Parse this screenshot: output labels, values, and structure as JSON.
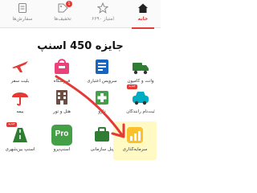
{
  "nav": {
    "home": {
      "label": "خانه",
      "icon": "home-icon"
    },
    "points": {
      "label": "۶۶۹۰ امتیاز",
      "icon": "star-icon"
    },
    "offers": {
      "label": "تخفیف‌ها",
      "badge": "1",
      "icon": "percent-tag-icon"
    },
    "orders": {
      "label": "سفارش‌ها",
      "icon": "orders-icon"
    }
  },
  "banner": {
    "text": "جایزه 450 اسنپ"
  },
  "tiles": [
    {
      "label": "وانت و کامیون",
      "icon": "truck-icon",
      "color": "#2e7d32"
    },
    {
      "label": "سرویس اعتباری",
      "icon": "credit-icon",
      "color": "#1565c0"
    },
    {
      "label": "فروشگاه",
      "icon": "shop-icon",
      "color": "#ec407a"
    },
    {
      "label": "بلیت سفر",
      "icon": "plane-icon",
      "color": "#e53935"
    },
    {
      "label": "ثبت‌نام رانندگان",
      "icon": "driver-icon",
      "color": "#00acc1",
      "tag": "جدید"
    },
    {
      "label": "دارو",
      "icon": "pharmacy-icon",
      "color": "#43a047"
    },
    {
      "label": "هتل و تور",
      "icon": "hotel-icon",
      "color": "#6d4c41"
    },
    {
      "label": "بیمه",
      "icon": "umbrella-icon",
      "color": "#e53935"
    },
    {
      "label": "سرمایه‌گذاری",
      "icon": "investment-icon",
      "color": "#fbc02d"
    },
    {
      "label": "پنل سازمانی",
      "icon": "org-panel-icon",
      "color": "#2e7d32"
    },
    {
      "label": "اسنپ‌پرو",
      "icon": "pro-icon",
      "color": "#43a047",
      "text": "Pro"
    },
    {
      "label": "اسنپ بین‌شهری",
      "icon": "intercity-icon",
      "color": "#2e7d32",
      "tag": "جدید"
    }
  ],
  "colors": {
    "accent": "#e53935",
    "arrow": "#e53935",
    "highlight": "#fff9c4"
  }
}
